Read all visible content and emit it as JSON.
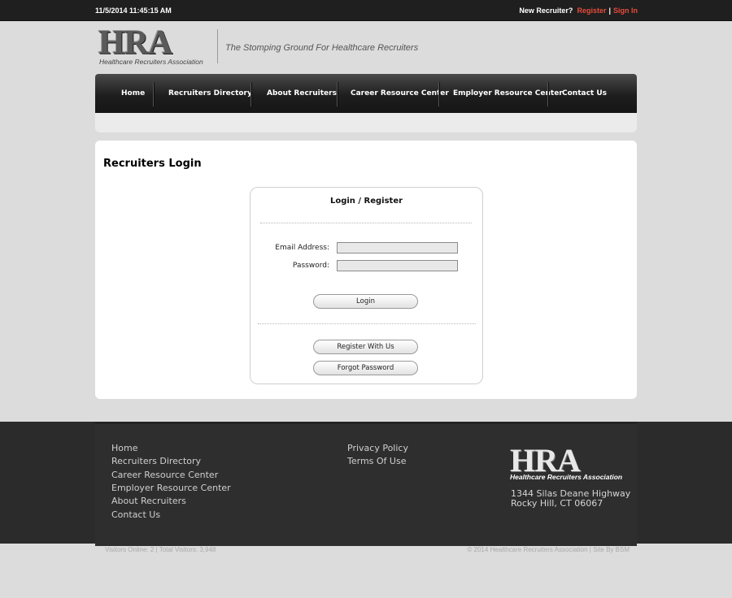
{
  "topbar": {
    "datetime": "11/5/2014  11:45:15 AM",
    "new_recruiter": "New Recruiter?",
    "register": "Register",
    "separator": "|",
    "sign_in": "Sign In"
  },
  "brand": {
    "logo": "HRA",
    "logo_sub": "Healthcare Recruiters Association",
    "tagline": "The Stomping Ground For Healthcare Recruiters"
  },
  "nav": {
    "items": [
      {
        "label": "Home"
      },
      {
        "label": "Recruiters Directory"
      },
      {
        "label": "About Recruiters"
      },
      {
        "label": "Career Resource Center"
      },
      {
        "label": "Employer Resource Center"
      },
      {
        "label": "Contact Us"
      }
    ]
  },
  "page": {
    "title": "Recruiters Login"
  },
  "login": {
    "title": "Login / Register",
    "email_label": "Email Address:",
    "email_value": "",
    "password_label": "Password:",
    "password_value": "",
    "login_button": "Login",
    "register_button": "Register With Us",
    "forgot_button": "Forgot Password"
  },
  "footer": {
    "col1": [
      {
        "label": "Home"
      },
      {
        "label": "Recruiters Directory"
      },
      {
        "label": "Career Resource Center"
      },
      {
        "label": "Employer Resource Center"
      },
      {
        "label": "About Recruiters"
      },
      {
        "label": "Contact Us"
      }
    ],
    "col2": [
      {
        "label": "Privacy Policy"
      },
      {
        "label": "Terms Of Use"
      }
    ],
    "logo": "HRA",
    "logo_sub": "Healthcare Recruiters Association",
    "address_line1": "1344 Silas Deane Highway",
    "address_line2": "Rocky Hill, CT 06067"
  },
  "bottom": {
    "visitors": "Visitors Online: 2 | Total Visitors: 3,948",
    "copyright": "© 2014 Healthcare Recruiters Association | Site By BSM"
  }
}
